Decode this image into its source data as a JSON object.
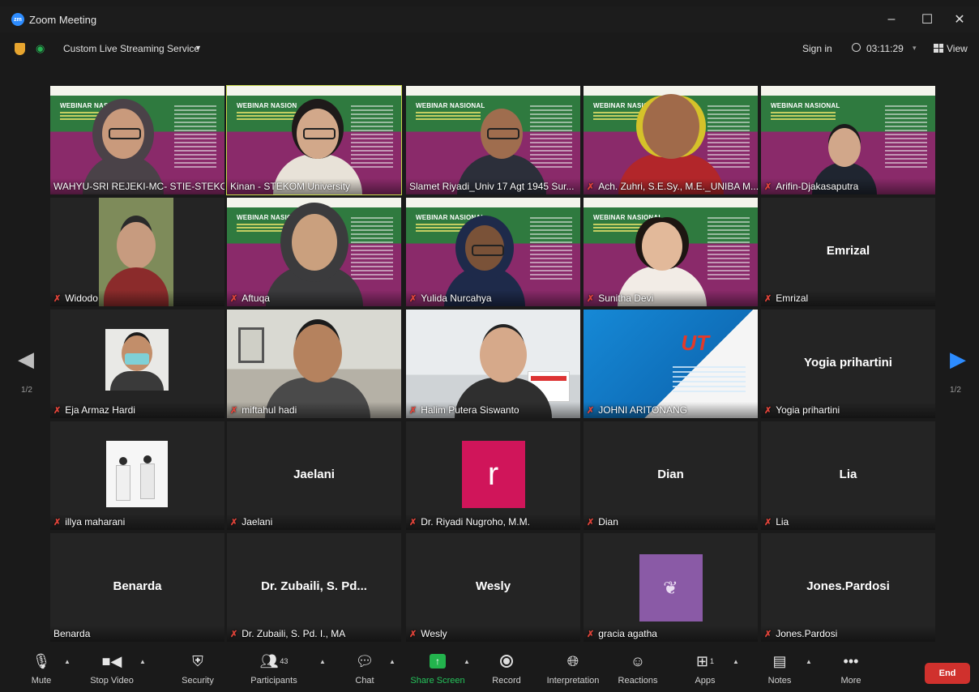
{
  "window": {
    "title": "Zoom Meeting",
    "app_icon": "zoom"
  },
  "topbar": {
    "streaming_label": "Custom Live Streaming Service",
    "sign_in": "Sign in",
    "timer": "03:11:29",
    "view_label": "View"
  },
  "gallery": {
    "page_indicator_left": "1/2",
    "page_indicator_right": "1/2",
    "webinar_title": "WEBINAR NASIONAL",
    "webinar_title_short": "WEBINAR NASION",
    "tiles": [
      {
        "name": "WAHYU-SRI REJEKI-MC- STIE-STEKO...",
        "muted": false
      },
      {
        "name": "Kinan - STEKOM University",
        "muted": false
      },
      {
        "name": "Slamet Riyadi_Univ 17 Agt 1945 Sur...",
        "muted": false
      },
      {
        "name": "Ach. Zuhri, S.E.Sy., M.E._UNIBA M...",
        "muted": true
      },
      {
        "name": "Arifin-Djakasaputra",
        "muted": true
      },
      {
        "name": "Widodo",
        "muted": true
      },
      {
        "name": "Aftuqa",
        "muted": true
      },
      {
        "name": "Yulida Nurcahya",
        "muted": true
      },
      {
        "name": "Sunitha Devi",
        "muted": true
      },
      {
        "name": "Emrizal",
        "muted": true,
        "display": "Emrizal"
      },
      {
        "name": "Eja Armaz Hardi",
        "muted": true
      },
      {
        "name": "miftahul hadi",
        "muted": true
      },
      {
        "name": "Halim Putera Siswanto",
        "muted": true
      },
      {
        "name": "JOHNI ARITONANG",
        "muted": true
      },
      {
        "name": "Yogia prihartini",
        "muted": true,
        "display": "Yogia prihartini"
      },
      {
        "name": "illya maharani",
        "muted": true
      },
      {
        "name": "Jaelani",
        "muted": true,
        "display": "Jaelani"
      },
      {
        "name": "Dr. Riyadi Nugroho, M.M.",
        "muted": true,
        "avatar_letter": "r"
      },
      {
        "name": "Dian",
        "muted": true,
        "display": "Dian"
      },
      {
        "name": "Lia",
        "muted": true,
        "display": "Lia"
      },
      {
        "name": "Benarda",
        "muted": false,
        "display": "Benarda"
      },
      {
        "name": "Dr. Zubaili, S. Pd. I., MA",
        "muted": true,
        "display": "Dr. Zubaili, S. Pd..."
      },
      {
        "name": "Wesly",
        "muted": true,
        "display": "Wesly"
      },
      {
        "name": "gracia agatha",
        "muted": true
      },
      {
        "name": "Jones.Pardosi",
        "muted": true,
        "display": "Jones.Pardosi"
      }
    ],
    "ut_card": {
      "text": "UT"
    }
  },
  "toolbar": {
    "mute": "Mute",
    "stop_video": "Stop Video",
    "security": "Security",
    "participants": "Participants",
    "participants_count": "43",
    "chat": "Chat",
    "share_screen": "Share Screen",
    "record": "Record",
    "interpretation": "Interpretation",
    "reactions": "Reactions",
    "apps": "Apps",
    "apps_count": "1",
    "notes": "Notes",
    "more": "More",
    "end": "End"
  },
  "colors": {
    "accent_blue": "#2d8cff",
    "share_green": "#23b34d",
    "end_red": "#d0312d",
    "mic_muted": "#e0443a",
    "active_speaker": "#c8d84b"
  }
}
